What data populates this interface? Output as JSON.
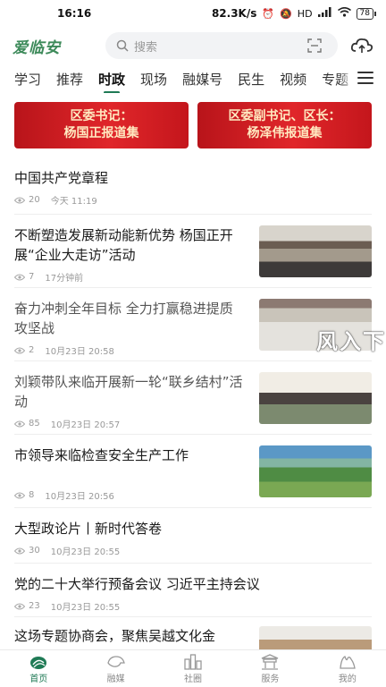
{
  "status_bar": {
    "time": "16:16",
    "net_speed": "82.3K/s",
    "signal": "HD",
    "battery": "78",
    "icons": [
      "alarm-icon",
      "mute-icon",
      "signal-icon",
      "wifi-icon",
      "battery-icon"
    ]
  },
  "header": {
    "logo": "爱临安",
    "search_placeholder": "搜索",
    "icons": [
      "search-icon",
      "scan-icon",
      "cloud-icon"
    ]
  },
  "tabs": [
    "学习",
    "推荐",
    "时政",
    "现场",
    "融媒号",
    "民生",
    "视频",
    "专题"
  ],
  "active_tab": "时政",
  "banners": [
    {
      "line1": "区委书记：",
      "line2": "杨国正报道集"
    },
    {
      "line1": "区委副书记、区长：",
      "line2": "杨泽伟报道集"
    }
  ],
  "news": [
    {
      "title": "中国共产党章程",
      "views": "20",
      "time": "今天 11:19"
    },
    {
      "title": "不断塑造发展新动能新优势 杨国正开展“企业大走访”活动",
      "views": "7",
      "time": "17分钟前",
      "image": "meeting"
    },
    {
      "title": "奋力冲刺全年目标 全力打赢稳进提质攻坚战",
      "views": "2",
      "time": "10月23日 20:58",
      "image": "hall"
    },
    {
      "title": "刘颖带队来临开展新一轮“联乡结村”活动",
      "views": "85",
      "time": "10月23日 20:57",
      "image": "group"
    },
    {
      "title": "市领导来临检查安全生产工作",
      "views": "8",
      "time": "10月23日 20:56",
      "image": "aerial"
    },
    {
      "title": "大型政论片丨新时代答卷",
      "views": "30",
      "time": "10月23日 20:55"
    },
    {
      "title": "党的二十大举行预备会议 习近平主持会议",
      "views": "23",
      "time": "10月23日 20:55"
    },
    {
      "title": "这场专题协商会，聚焦吴越文化金",
      "image": "room"
    }
  ],
  "overlay_text": "风入下",
  "bottom_nav": [
    {
      "label": "首页",
      "icon": "home-icon",
      "active": true
    },
    {
      "label": "融媒",
      "icon": "media-icon",
      "active": false
    },
    {
      "label": "社圈",
      "icon": "community-icon",
      "active": false
    },
    {
      "label": "服务",
      "icon": "service-icon",
      "active": false
    },
    {
      "label": "我的",
      "icon": "profile-icon",
      "active": false
    }
  ],
  "colors": {
    "accent": "#1f7a55",
    "banner_red": "#d8222a",
    "logo_green": "#3d8a5a"
  }
}
